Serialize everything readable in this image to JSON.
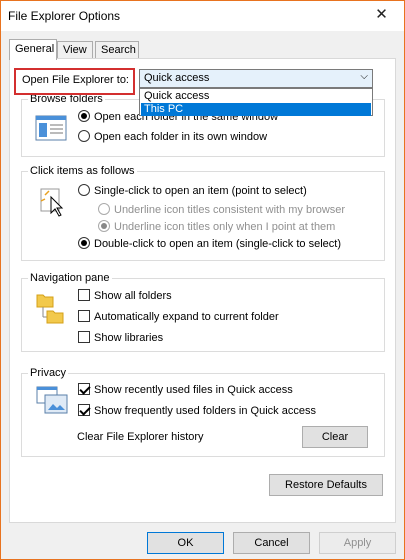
{
  "window": {
    "title": "File Explorer Options",
    "close_glyph": "✕"
  },
  "tabs": [
    {
      "label": "General"
    },
    {
      "label": "View"
    },
    {
      "label": "Search"
    }
  ],
  "open_explorer": {
    "label": "Open File Explorer to:",
    "value": "Quick access",
    "options": [
      "Quick access",
      "This PC"
    ],
    "highlighted": "This PC"
  },
  "browse_folders": {
    "title": "Browse folders",
    "opt_same": "Open each folder in the same window",
    "opt_own": "Open each folder in its own window",
    "selected": "same"
  },
  "click_items": {
    "title": "Click items as follows",
    "opt_single": "Single-click to open an item (point to select)",
    "sub_browser": "Underline icon titles consistent with my browser",
    "sub_point": "Underline icon titles only when I point at them",
    "opt_double": "Double-click to open an item (single-click to select)",
    "selected": "double"
  },
  "navigation_pane": {
    "title": "Navigation pane",
    "show_all_folders": "Show all folders",
    "auto_expand": "Automatically expand to current folder",
    "show_libraries": "Show libraries"
  },
  "privacy": {
    "title": "Privacy",
    "recent_files": "Show recently used files in Quick access",
    "frequent_folders": "Show frequently used folders in Quick access",
    "clear_history_label": "Clear File Explorer history",
    "clear_button": "Clear"
  },
  "buttons": {
    "restore_defaults": "Restore Defaults",
    "ok": "OK",
    "cancel": "Cancel",
    "apply": "Apply"
  },
  "colors": {
    "accent": "#0078d7",
    "highlight_box": "#d32f2f",
    "window_border": "#e8731f"
  }
}
